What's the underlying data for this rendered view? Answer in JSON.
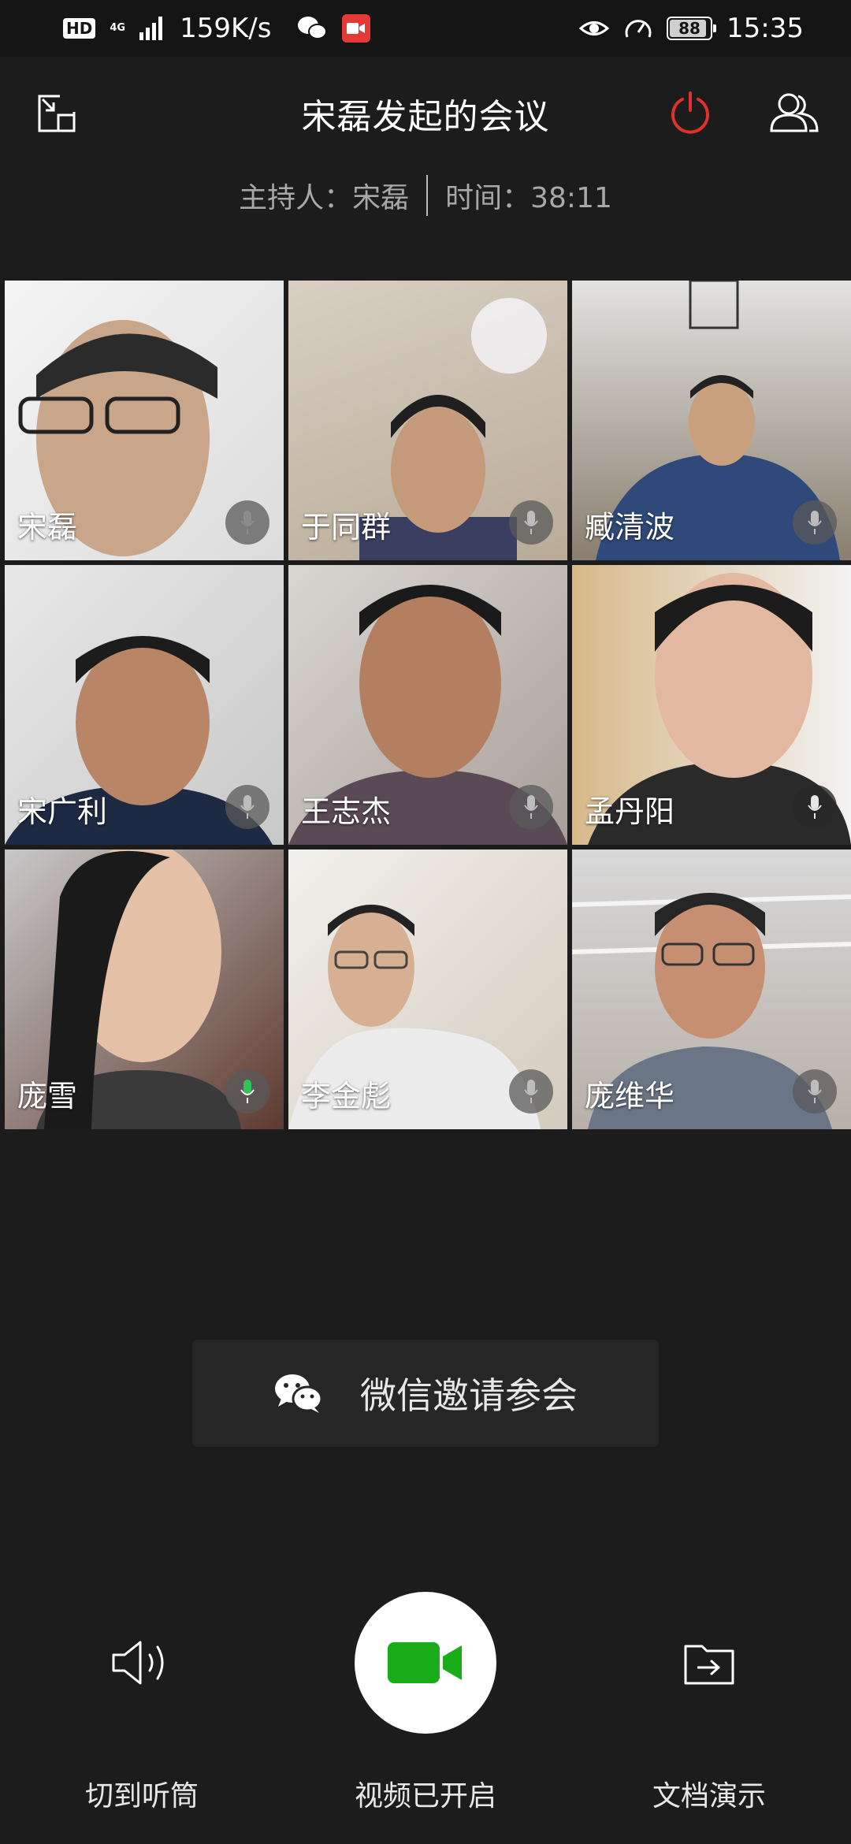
{
  "status_bar": {
    "hd": "HD",
    "network_type": "4G",
    "speed": "159K/s",
    "battery": "88",
    "time": "15:35"
  },
  "header": {
    "title": "宋磊发起的会议",
    "host_label": "主持人：宋磊",
    "time_label": "时间：38:11"
  },
  "participants": [
    {
      "name": "宋磊",
      "mic": "muted"
    },
    {
      "name": "于同群",
      "mic": "muted"
    },
    {
      "name": "臧清波",
      "mic": "muted"
    },
    {
      "name": "宋广利",
      "mic": "muted"
    },
    {
      "name": "王志杰",
      "mic": "muted"
    },
    {
      "name": "孟丹阳",
      "mic": "muted"
    },
    {
      "name": "庞雪",
      "mic": "speaking"
    },
    {
      "name": "李金彪",
      "mic": "muted"
    },
    {
      "name": "庞维华",
      "mic": "muted"
    }
  ],
  "invite": {
    "label": "微信邀请参会"
  },
  "controls": {
    "earpiece_label": "切到听筒",
    "video_label": "视频已开启",
    "doc_label": "文档演示"
  },
  "colors": {
    "background": "#1c1c1c",
    "hangup": "#e0322a",
    "video_green": "#1aad19",
    "mic_active": "#2ec55a"
  }
}
